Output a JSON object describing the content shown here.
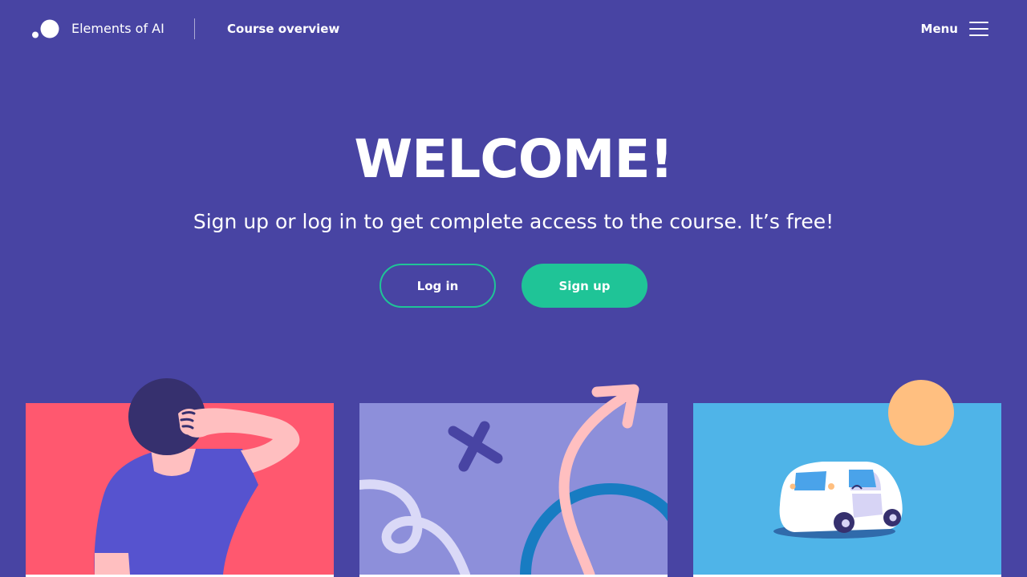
{
  "header": {
    "brand": "Elements of AI",
    "course_overview": "Course overview",
    "menu_label": "Menu"
  },
  "hero": {
    "title": "WELCOME!",
    "subtitle": "Sign up or log in to get complete access to the course. It’s free!",
    "login_label": "Log in",
    "signup_label": "Sign up"
  },
  "colors": {
    "background": "#4844a3",
    "accent_green": "#1fc497",
    "card1": "#ff586f",
    "card2": "#8d8fda",
    "card3": "#4fb4e8"
  },
  "icons": {
    "logo": "two-dots-logo",
    "menu": "hamburger-icon"
  },
  "cards": [
    {
      "illustration": "person-scratching-head"
    },
    {
      "illustration": "cross-and-arrow-path"
    },
    {
      "illustration": "self-driving-car"
    }
  ]
}
